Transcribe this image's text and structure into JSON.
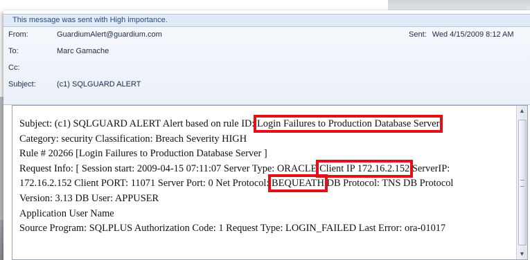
{
  "info_bar": {
    "text": "This message was sent with High importance."
  },
  "header": {
    "from": {
      "label": "From:",
      "value": "GuardiumAlert@guardium.com"
    },
    "to": {
      "label": "To:",
      "value": "Marc Gamache"
    },
    "cc": {
      "label": "Cc:",
      "value": ""
    },
    "subject": {
      "label": "Subject:",
      "value": "(c1) SQLGUARD ALERT"
    },
    "sent": {
      "label": "Sent:",
      "value": "Wed 4/15/2009 8:12 AM"
    }
  },
  "body": {
    "line1_a": "Subject: (c1) SQLGUARD ALERT Alert based on rule ID: ",
    "line1_hl": "Login Failures to Production Database Server",
    "line2": "Category: security Classification: Breach Severity HIGH",
    "line3": "Rule # 20266 [Login Failures to Production Database Server ]",
    "line4_a": "Request Info: [ Session start: 2009-04-15 07:11:07 Server Type: ORACLE ",
    "line4_hl": "Client IP 172.16.2.152",
    "line4_b": " ServerIP:",
    "line5_a": "172.16.2.152 Client PORT: 11071 Server Port: 0 Net Protocol: ",
    "line5_hl": "BEQUEATH",
    "line5_b": " DB Protocol: TNS DB Protocol",
    "line6": "Version: 3.13 DB User: APPUSER",
    "line7": "Application User Name",
    "line8": "Source Program: SQLPLUS Authorization Code: 1 Request Type: LOGIN_FAILED Last Error: ora-01017"
  },
  "icons": {
    "scroll_up": "scroll-up-arrow-icon",
    "scroll_down": "scroll-down-arrow-icon"
  },
  "colors": {
    "highlight_box": "#e3101a",
    "info_bar_bg": "#e1ebf8"
  }
}
